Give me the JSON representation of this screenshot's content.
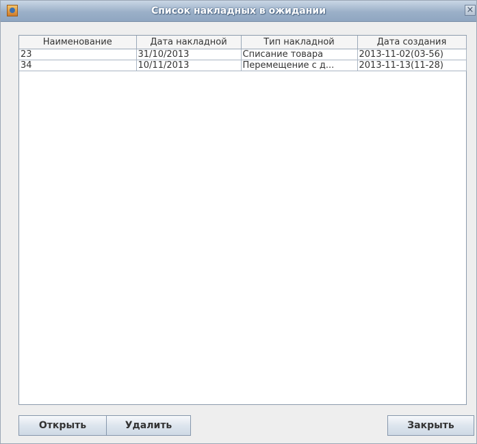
{
  "window": {
    "title": "Список накладных в ожидании"
  },
  "table": {
    "columns": [
      "Наименование",
      "Дата накладной",
      "Тип накладной",
      "Дата создания"
    ],
    "rows": [
      [
        "23",
        "31/10/2013",
        "Списание товара",
        "2013-11-02(03-56)"
      ],
      [
        "34",
        "10/11/2013",
        "Перемещение с д...",
        "2013-11-13(11-28)"
      ]
    ]
  },
  "buttons": {
    "open": "Открыть",
    "delete": "Удалить",
    "close": "Закрыть"
  },
  "icons": {
    "app": "java-cup-icon",
    "close": "close-icon"
  },
  "close_glyph": "×"
}
